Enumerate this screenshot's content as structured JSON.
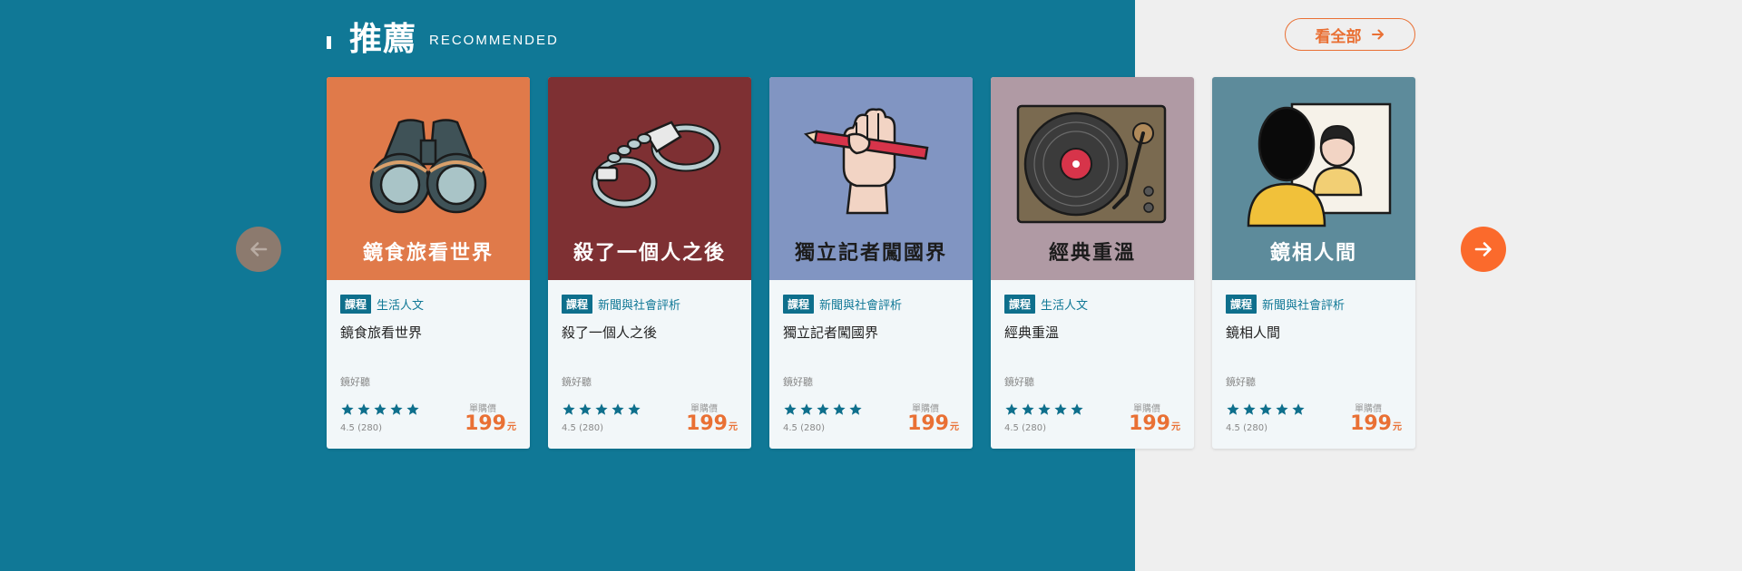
{
  "section": {
    "title": "推薦",
    "subtitle": "RECOMMENDED",
    "see_all_label": "看全部"
  },
  "colors": {
    "teal_bg": "#107896",
    "accent_orange": "#fb6a2c",
    "price_orange": "#e97034",
    "tag_teal": "#0e6f8c"
  },
  "nav": {
    "prev_icon": "arrow-left-icon",
    "next_icon": "arrow-right-icon"
  },
  "cards": [
    {
      "cover_title": "鏡食旅看世界",
      "cover_color": "#e07a4a",
      "cover_title_color": "#ffffff",
      "icon": "binoculars-icon",
      "tag": "課程",
      "category": "生活人文",
      "title": "鏡食旅看世界",
      "provider": "鏡好聽",
      "rating": "4.5 (280)",
      "price_label": "單購價",
      "price": "199",
      "currency": "元",
      "stars": 5
    },
    {
      "cover_title": "殺了一個人之後",
      "cover_color": "#7e3033",
      "cover_title_color": "#ffffff",
      "icon": "handcuffs-icon",
      "tag": "課程",
      "category": "新聞與社會評析",
      "title": "殺了一個人之後",
      "provider": "鏡好聽",
      "rating": "4.5 (280)",
      "price_label": "單購價",
      "price": "199",
      "currency": "元",
      "stars": 5
    },
    {
      "cover_title": "獨立記者闖國界",
      "cover_color": "#8195c2",
      "cover_title_color": "#1c1c1c",
      "icon": "fist-pencil-icon",
      "tag": "課程",
      "category": "新聞與社會評析",
      "title": "獨立記者闖國界",
      "provider": "鏡好聽",
      "rating": "4.5 (280)",
      "price_label": "單購價",
      "price": "199",
      "currency": "元",
      "stars": 5
    },
    {
      "cover_title": "經典重溫",
      "cover_color": "#b09aa4",
      "cover_title_color": "#1c1c1c",
      "icon": "turntable-icon",
      "tag": "課程",
      "category": "生活人文",
      "title": "經典重溫",
      "provider": "鏡好聽",
      "rating": "4.5 (280)",
      "price_label": "單購價",
      "price": "199",
      "currency": "元",
      "stars": 5
    },
    {
      "cover_title": "鏡相人間",
      "cover_color": "#5d8b9b",
      "cover_title_color": "#ffffff",
      "icon": "portrait-icon",
      "tag": "課程",
      "category": "新聞與社會評析",
      "title": "鏡相人間",
      "provider": "鏡好聽",
      "rating": "4.5 (280)",
      "price_label": "單購價",
      "price": "199",
      "currency": "元",
      "stars": 5
    }
  ]
}
